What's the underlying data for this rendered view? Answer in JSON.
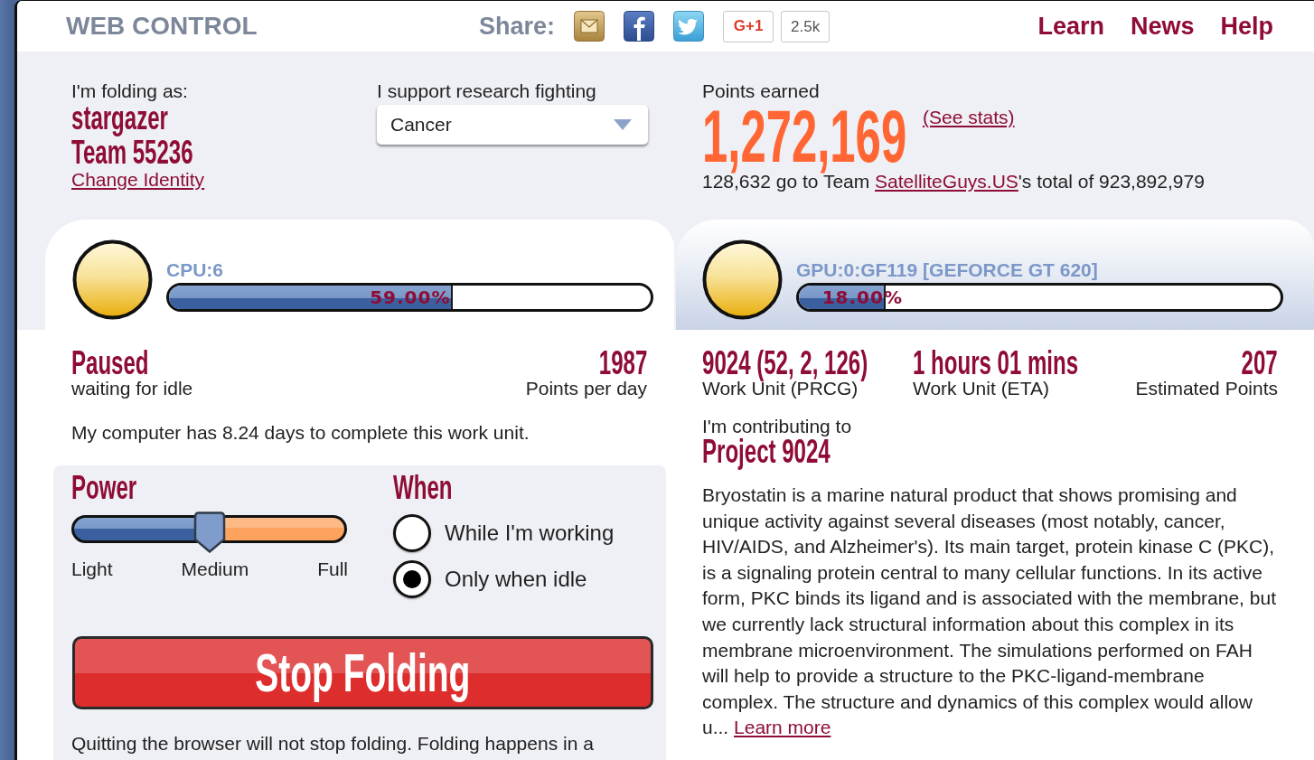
{
  "header": {
    "title": "WEB CONTROL",
    "share": {
      "label": "Share:",
      "plus_one": {
        "label": "G+1",
        "count": "2.5k"
      }
    },
    "nav": [
      {
        "label": "Learn"
      },
      {
        "label": "News"
      },
      {
        "label": "Help"
      }
    ]
  },
  "identity": {
    "label": "I'm folding as:",
    "user": "stargazer",
    "team": "Team 55236",
    "link": "Change Identity"
  },
  "cause": {
    "label": "I support research fighting",
    "value": "Cancer"
  },
  "points": {
    "label": "Points earned",
    "total": "1,272,169",
    "stats_link": "(See stats)",
    "team_line": {
      "before": "128,632 go to Team ",
      "link": "SatelliteGuys.US",
      "after": "'s total of 923,892,979"
    }
  },
  "slots": [
    {
      "name": "CPU:6",
      "selected": true,
      "level": 0.59,
      "reading": "59.00%"
    },
    {
      "name": "GPU:0:GF119 [GEFORCE GT 620]",
      "selected": false,
      "level": 0.18,
      "reading": "18.00%"
    }
  ],
  "status": {
    "title": "Paused",
    "subtitle": "waiting for idle",
    "ppd": "1987",
    "ppd_label": "Points per day",
    "deadline": "My computer has 8.24 days to complete this work unit."
  },
  "power": {
    "title": "Power",
    "level": 0.5,
    "labels": [
      "Light",
      "Medium",
      "Full"
    ]
  },
  "when": {
    "title": "When",
    "options": [
      {
        "label": "While I'm working",
        "selected": false
      },
      {
        "label": "Only when idle",
        "selected": true
      }
    ]
  },
  "stop_button": {
    "label": "Stop Folding"
  },
  "note": "Quitting the browser will not stop folding. Folding happens in a",
  "work_unit": {
    "stats": [
      {
        "value": "9024 (52, 2, 126)",
        "label": "Work Unit (PRCG)"
      },
      {
        "value": "1 hours 01 mins",
        "label": "Work Unit (ETA)"
      },
      {
        "value": "207",
        "label": "Estimated Points"
      }
    ],
    "contributing_label": "I'm contributing to",
    "project": "Project 9024",
    "description": "Bryostatin is a marine natural product that shows promising and unique activity against several diseases (most notably, cancer, HIV/AIDS, and Alzheimer's). Its main target, protein kinase C (PKC), is a signaling protein central to many cellular functions. In its active form, PKC binds its ligand and is associated with the membrane, but we currently lack structural information about this complex in its membrane microenvironment. The simulations performed on FAH will help to provide a structure to the PKC-ligand-membrane complex. The structure and dynamics of this complex would allow u...",
    "link": "Learn more"
  }
}
